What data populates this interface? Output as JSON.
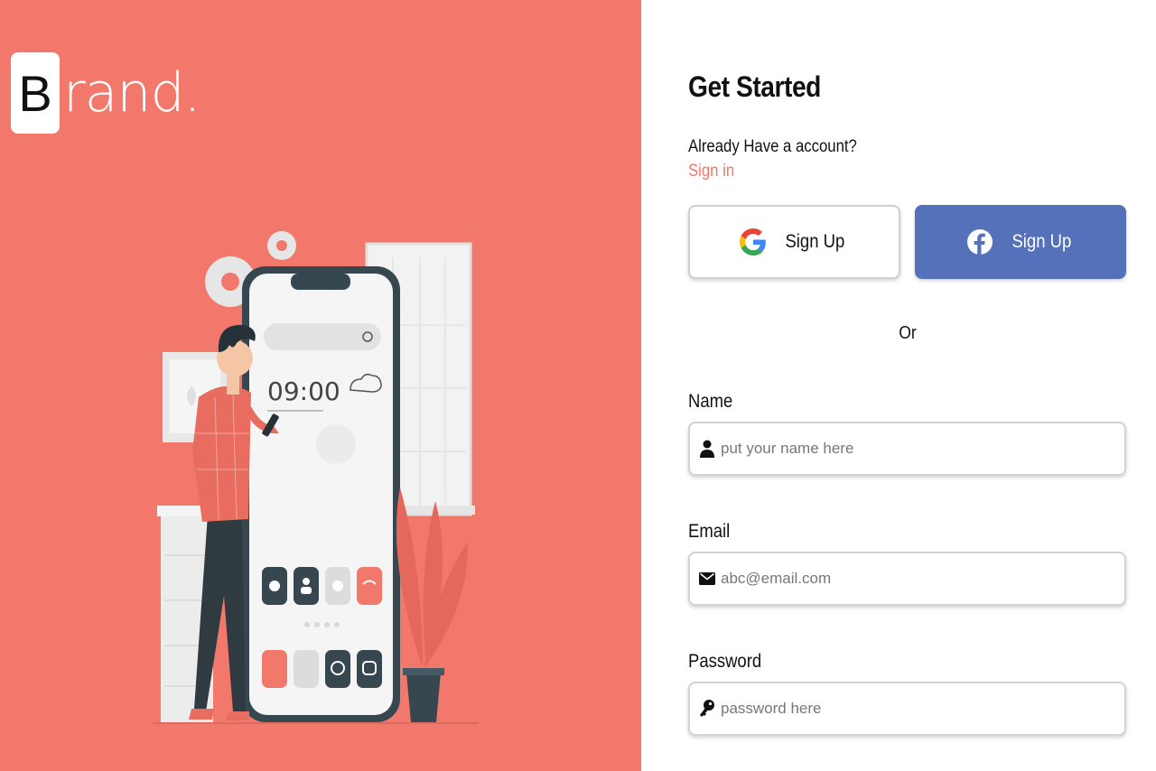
{
  "brand": {
    "initial": "B",
    "rest": "rand."
  },
  "illustration": {
    "clock": "09:00"
  },
  "form": {
    "title": "Get Started",
    "already_text": "Already Have a account?",
    "signin_link": "Sign in",
    "google_button": "Sign Up",
    "facebook_button": "Sign Up",
    "or_text": "Or",
    "name": {
      "label": "Name",
      "placeholder": "put your name here",
      "icon": "user-icon"
    },
    "email": {
      "label": "Email",
      "placeholder": "abc@email.com",
      "icon": "envelope-icon"
    },
    "password": {
      "label": "Password",
      "placeholder": "password here",
      "icon": "key-icon"
    }
  },
  "colors": {
    "accent": "#f1786b",
    "facebook": "#5471b9",
    "dark": "#37474f"
  }
}
